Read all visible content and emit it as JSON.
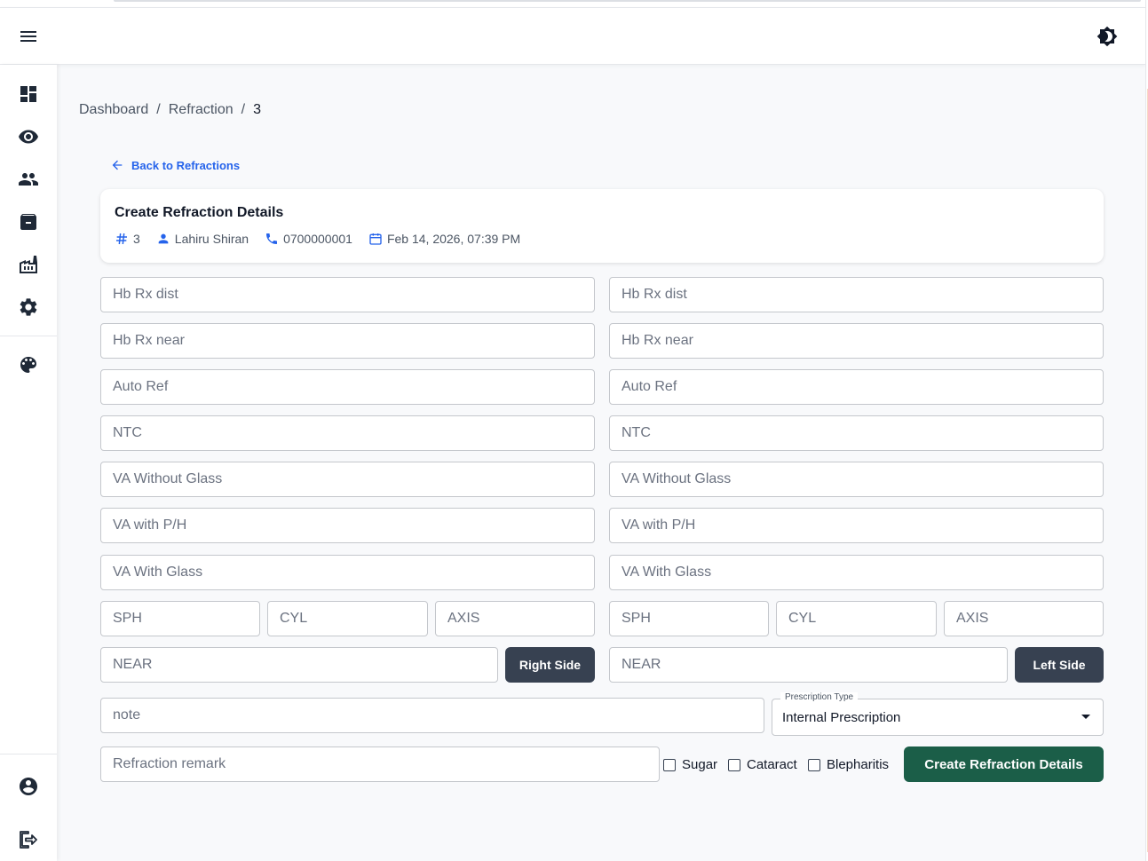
{
  "header": {
    "menu_icon": "menu-icon",
    "theme_icon": "brightness-icon"
  },
  "sidebar": {
    "items": [
      {
        "name": "dashboard",
        "icon": "dashboard-icon"
      },
      {
        "name": "refraction",
        "icon": "eye-icon"
      },
      {
        "name": "patients",
        "icon": "people-icon"
      },
      {
        "name": "inventory",
        "icon": "archive-icon"
      },
      {
        "name": "factory",
        "icon": "factory-icon"
      },
      {
        "name": "settings",
        "icon": "gear-icon"
      },
      {
        "name": "theme",
        "icon": "palette-icon"
      },
      {
        "name": "account",
        "icon": "account-circle-icon"
      },
      {
        "name": "logout",
        "icon": "logout-icon"
      }
    ]
  },
  "breadcrumb": {
    "items": [
      "Dashboard",
      "Refraction",
      "3"
    ],
    "separator": "/"
  },
  "back_link": "Back to Refractions",
  "card": {
    "title": "Create Refraction Details",
    "id": "3",
    "patient_name": "Lahiru Shiran",
    "phone": "0700000001",
    "date": "Feb 14, 2026, 07:39 PM"
  },
  "right": {
    "hb_rx_dist": "Hb Rx dist",
    "hb_rx_near": "Hb Rx near",
    "auto_ref": "Auto Ref",
    "ntc": "NTC",
    "va_without_glass": "VA Without Glass",
    "va_with_ph": "VA with P/H",
    "va_with_glass": "VA With Glass",
    "sph": "SPH",
    "cyl": "CYL",
    "axis": "AXIS",
    "near": "NEAR",
    "button": "Right Side"
  },
  "left": {
    "hb_rx_dist": "Hb Rx dist",
    "hb_rx_near": "Hb Rx near",
    "auto_ref": "Auto Ref",
    "ntc": "NTC",
    "va_without_glass": "VA Without Glass",
    "va_with_ph": "VA with P/H",
    "va_with_glass": "VA With Glass",
    "sph": "SPH",
    "cyl": "CYL",
    "axis": "AXIS",
    "near": "NEAR",
    "button": "Left Side"
  },
  "note_placeholder": "note",
  "prescription_type": {
    "label": "Prescription Type",
    "value": "Internal Prescription"
  },
  "remark_placeholder": "Refraction remark",
  "checkboxes": [
    {
      "label": "Sugar",
      "checked": false
    },
    {
      "label": "Cataract",
      "checked": false
    },
    {
      "label": "Blepharitis",
      "checked": false
    }
  ],
  "submit_label": "Create Refraction Details",
  "colors": {
    "primary": "#1b5e48",
    "side_button": "#374151",
    "link": "#2563eb"
  }
}
